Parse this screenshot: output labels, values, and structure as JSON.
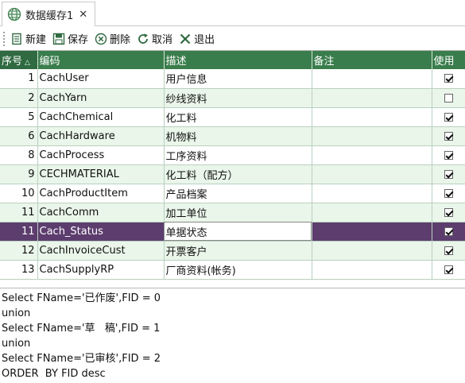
{
  "tab": {
    "title": "数据缓存1",
    "close": "✕"
  },
  "toolbar": {
    "new": "新建",
    "save": "保存",
    "delete": "删除",
    "cancel": "取消",
    "exit": "退出"
  },
  "colors": {
    "header_bg": "#3a7d4c",
    "row_alt": "#eaf6ea",
    "selected": "#5d3d6e"
  },
  "grid": {
    "columns": [
      "序号",
      "编码",
      "描述",
      "备注",
      "使用"
    ],
    "sort_indicator": "△",
    "rows": [
      {
        "seq": "1",
        "code": "CachUser",
        "desc": "用户信息",
        "note": "",
        "use": true
      },
      {
        "seq": "2",
        "code": "CachYarn",
        "desc": "纱线资料",
        "note": "",
        "use": false
      },
      {
        "seq": "5",
        "code": "CachChemical",
        "desc": "化工料",
        "note": "",
        "use": true
      },
      {
        "seq": "6",
        "code": "CachHardware",
        "desc": "机物料",
        "note": "",
        "use": true
      },
      {
        "seq": "8",
        "code": "CachProcess",
        "desc": "工序资料",
        "note": "",
        "use": true
      },
      {
        "seq": "9",
        "code": "CECHMATERIAL",
        "desc": "化工料（配方）",
        "note": "",
        "use": true
      },
      {
        "seq": "10",
        "code": "CachProductItem",
        "desc": "产品档案",
        "note": "",
        "use": true
      },
      {
        "seq": "11",
        "code": "CachComm",
        "desc": "加工单位",
        "note": "",
        "use": true
      },
      {
        "seq": "11",
        "code": "Cach_Status",
        "desc": "单据状态",
        "note": "",
        "use": true,
        "selected": true
      },
      {
        "seq": "12",
        "code": "CachInvoiceCust",
        "desc": "开票客户",
        "note": "",
        "use": true
      },
      {
        "seq": "13",
        "code": "CachSupplyRP",
        "desc": "厂商资料(帐务)",
        "note": "",
        "use": true
      }
    ]
  },
  "sql_lines": [
    "Select FName='已作废',FID = 0",
    "union",
    "Select FName='草   稿',FID = 1",
    "union",
    "Select FName='已审核',FID = 2",
    "ORDER  BY FID desc"
  ]
}
